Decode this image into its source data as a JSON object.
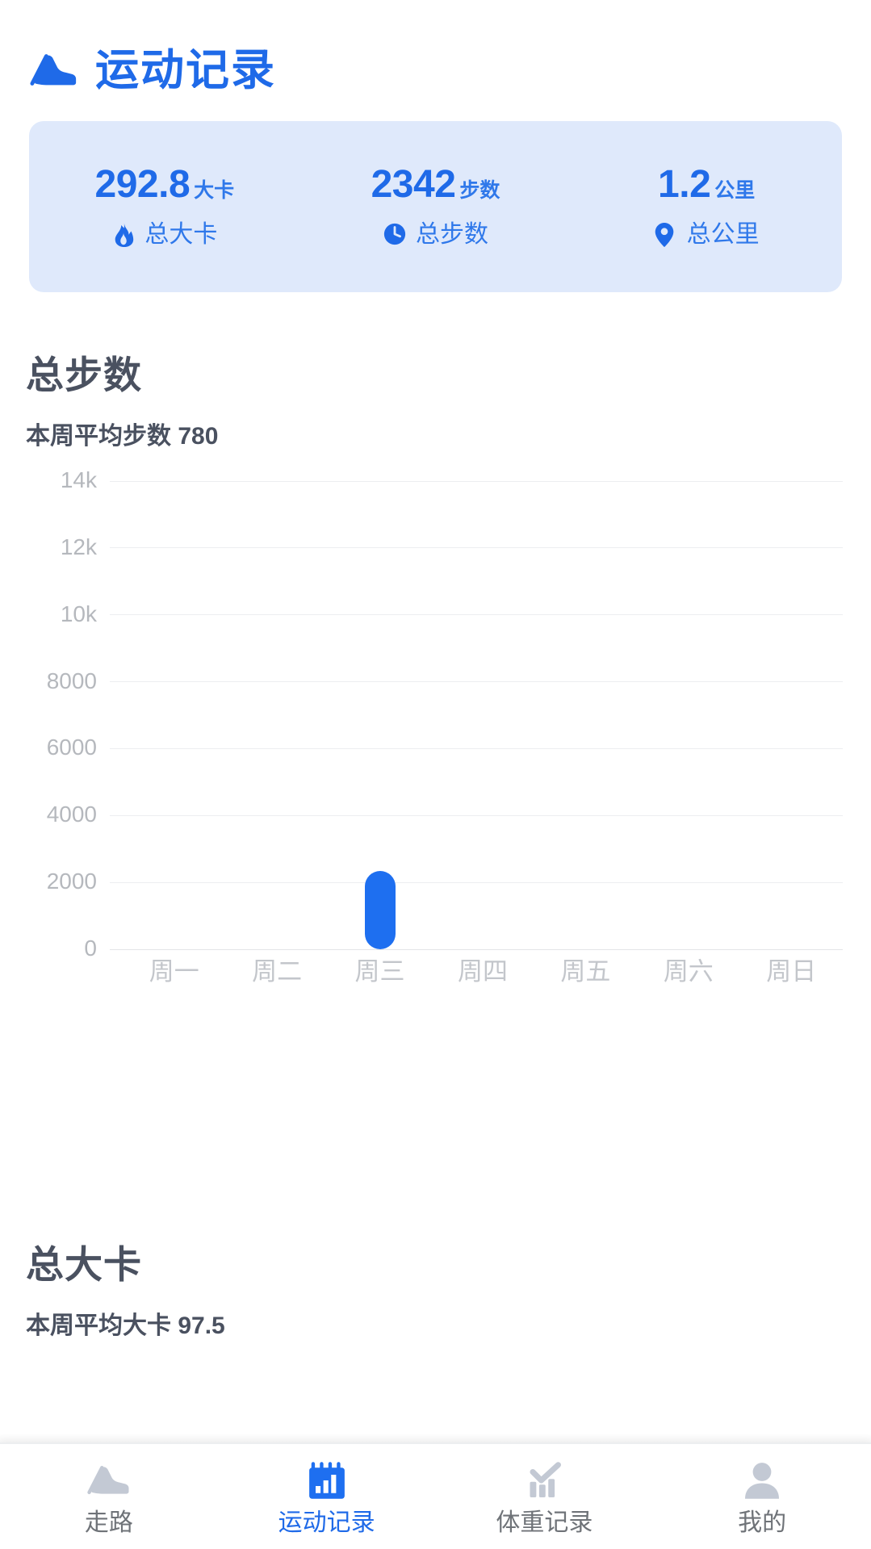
{
  "header": {
    "title": "运动记录",
    "icon": "shoe-icon",
    "accent_color": "#1f6ae8"
  },
  "summary": {
    "background_color": "#dfe9fb",
    "items": [
      {
        "value": "292.8",
        "unit": "大卡",
        "label": "总大卡",
        "icon": "fire-icon"
      },
      {
        "value": "2342",
        "unit": "步数",
        "label": "总步数",
        "icon": "clock-icon"
      },
      {
        "value": "1.2",
        "unit": "公里",
        "label": "总公里",
        "icon": "location-pin-icon"
      }
    ]
  },
  "sections": [
    {
      "title": "总步数",
      "subtitle": "本周平均步数 780"
    },
    {
      "title": "总大卡",
      "subtitle": "本周平均大卡 97.5"
    }
  ],
  "chart_data": {
    "type": "bar",
    "title": "总步数",
    "subtitle": "本周平均步数 780",
    "categories": [
      "周一",
      "周二",
      "周三",
      "周四",
      "周五",
      "周六",
      "周日"
    ],
    "values": [
      0,
      0,
      2342,
      0,
      0,
      0,
      0
    ],
    "ytick_labels": [
      "14k",
      "12k",
      "10k",
      "8000",
      "6000",
      "4000",
      "2000",
      "0"
    ],
    "ytick_values": [
      14000,
      12000,
      10000,
      8000,
      6000,
      4000,
      2000,
      0
    ],
    "ylim": [
      0,
      14000
    ],
    "xlabel": "",
    "ylabel": "",
    "grid": true,
    "legend": "none",
    "bar_color": "#1e6ff0",
    "grid_color": "#eceef0",
    "tick_label_color": "#b5b8bd"
  },
  "tabbar": {
    "active_color": "#1f6ae8",
    "inactive_color": "#6f7378",
    "items": [
      {
        "label": "走路",
        "icon": "shoe-icon",
        "active": false
      },
      {
        "label": "运动记录",
        "icon": "chart-clipboard-icon",
        "active": true
      },
      {
        "label": "体重记录",
        "icon": "bar-chart-check-icon",
        "active": false
      },
      {
        "label": "我的",
        "icon": "person-icon",
        "active": false
      }
    ]
  }
}
